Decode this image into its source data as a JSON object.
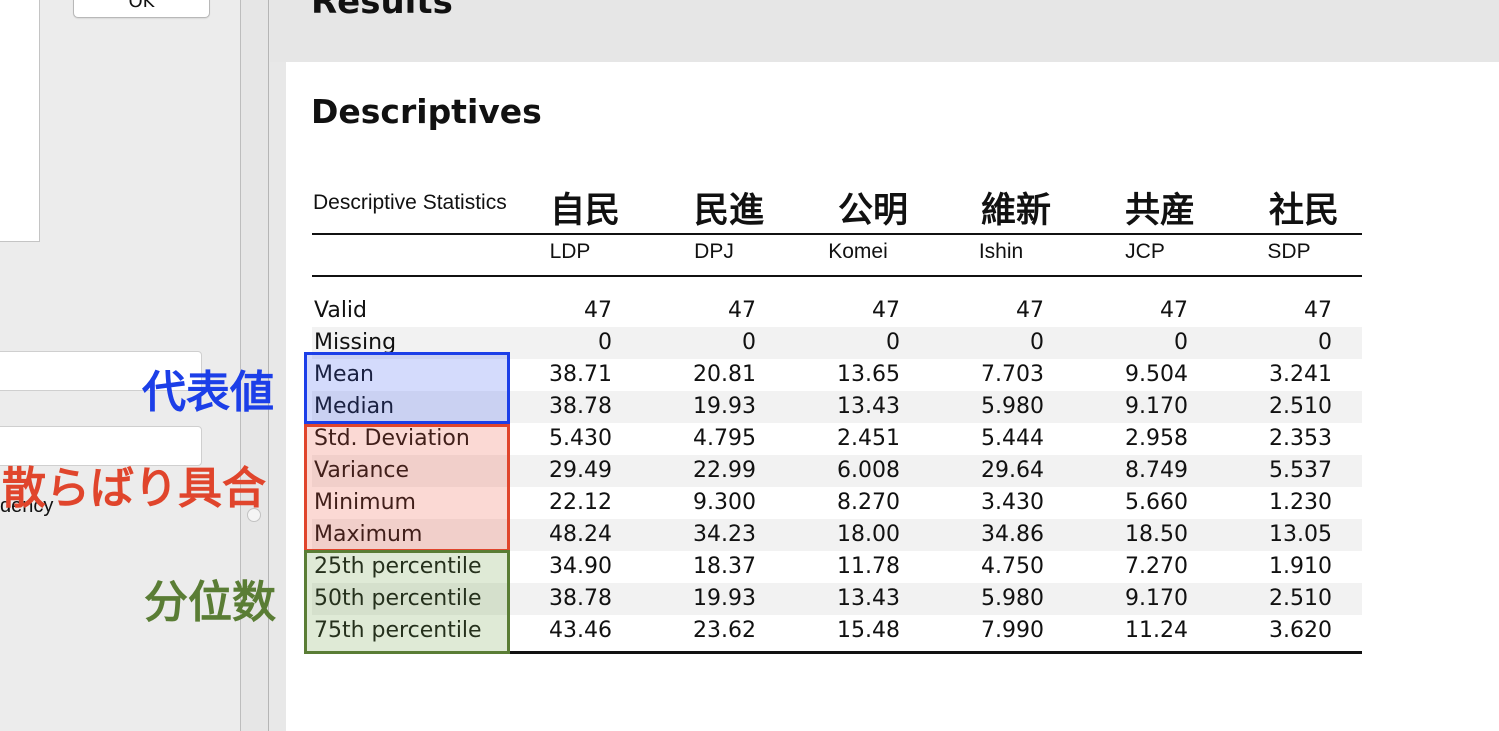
{
  "left_panel": {
    "ok_label": "OK",
    "partial_text": "dency"
  },
  "header": {
    "title": "Results"
  },
  "analysis": {
    "title": "Descriptives",
    "table_caption": "Descriptive Statistics",
    "party_labels_ja": [
      "自民",
      "民進",
      "公明",
      "維新",
      "共産",
      "社民"
    ],
    "columns": [
      "LDP",
      "DPJ",
      "Komei",
      "Ishin",
      "JCP",
      "SDP"
    ],
    "rows": [
      {
        "label": "Valid",
        "values": [
          "47",
          "47",
          "47",
          "47",
          "47",
          "47"
        ]
      },
      {
        "label": "Missing",
        "values": [
          "0",
          "0",
          "0",
          "0",
          "0",
          "0"
        ]
      },
      {
        "label": "Mean",
        "values": [
          "38.71",
          "20.81",
          "13.65",
          "7.703",
          "9.504",
          "3.241"
        ]
      },
      {
        "label": "Median",
        "values": [
          "38.78",
          "19.93",
          "13.43",
          "5.980",
          "9.170",
          "2.510"
        ]
      },
      {
        "label": "Std. Deviation",
        "values": [
          "5.430",
          "4.795",
          "2.451",
          "5.444",
          "2.958",
          "2.353"
        ]
      },
      {
        "label": "Variance",
        "values": [
          "29.49",
          "22.99",
          "6.008",
          "29.64",
          "8.749",
          "5.537"
        ]
      },
      {
        "label": "Minimum",
        "values": [
          "22.12",
          "9.300",
          "8.270",
          "3.430",
          "5.660",
          "1.230"
        ]
      },
      {
        "label": "Maximum",
        "values": [
          "48.24",
          "34.23",
          "18.00",
          "34.86",
          "18.50",
          "13.05"
        ]
      },
      {
        "label": "25th percentile",
        "values": [
          "34.90",
          "18.37",
          "11.78",
          "4.750",
          "7.270",
          "1.910"
        ]
      },
      {
        "label": "50th percentile",
        "values": [
          "38.78",
          "19.93",
          "13.43",
          "5.980",
          "9.170",
          "2.510"
        ]
      },
      {
        "label": "75th percentile",
        "values": [
          "43.46",
          "23.62",
          "15.48",
          "7.990",
          "11.24",
          "3.620"
        ]
      }
    ]
  },
  "annotations": {
    "central_tendency": "代表値",
    "dispersion": "散らばり具合",
    "quantiles": "分位数",
    "colors": {
      "blue": "#1c3fe8",
      "red": "#e0452c",
      "green": "#5a7d35"
    }
  }
}
